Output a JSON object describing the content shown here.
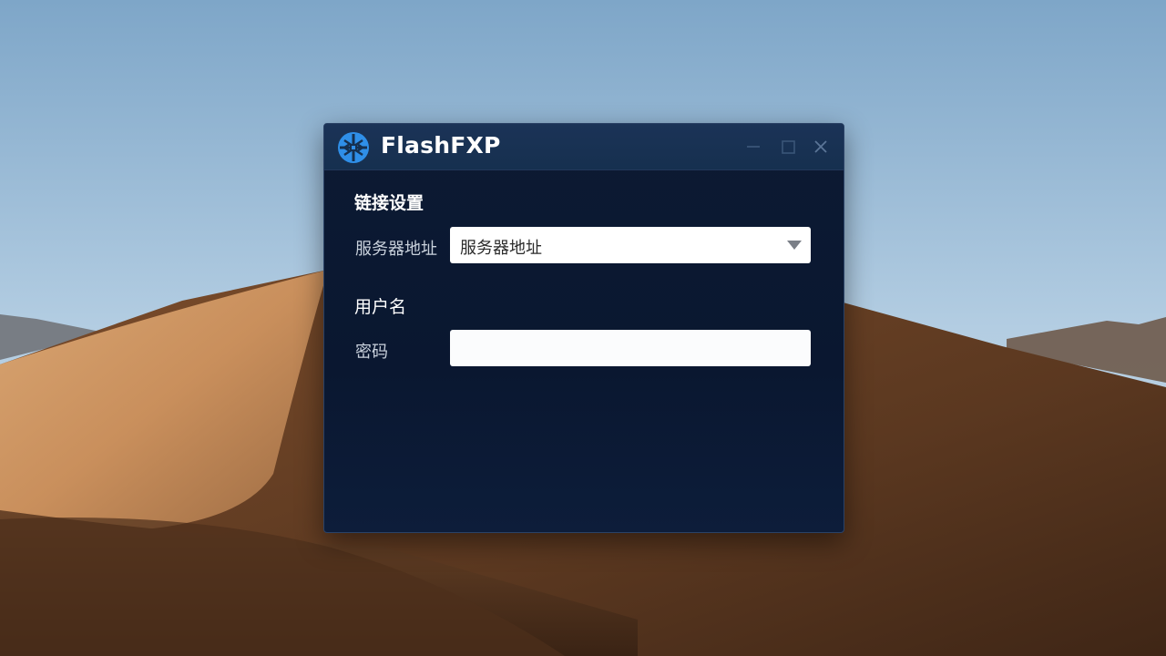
{
  "window": {
    "title": "FlashFXP",
    "controls": {
      "minimize_icon": "minimize-icon",
      "maximize_icon": "maximize-icon",
      "close_icon": "close-icon"
    }
  },
  "form": {
    "section_title": "链接设置",
    "server_label": "服务器地址",
    "server_value": "服务器地址",
    "username_label": "用户名",
    "password_label": "密码",
    "password_value": ""
  },
  "colors": {
    "window_bg": "#0a1730",
    "titlebar_bg": "#16304f",
    "logo_blue": "#2f8fe8",
    "text_white": "#ffffff",
    "label_gray": "#c9d1dc"
  }
}
